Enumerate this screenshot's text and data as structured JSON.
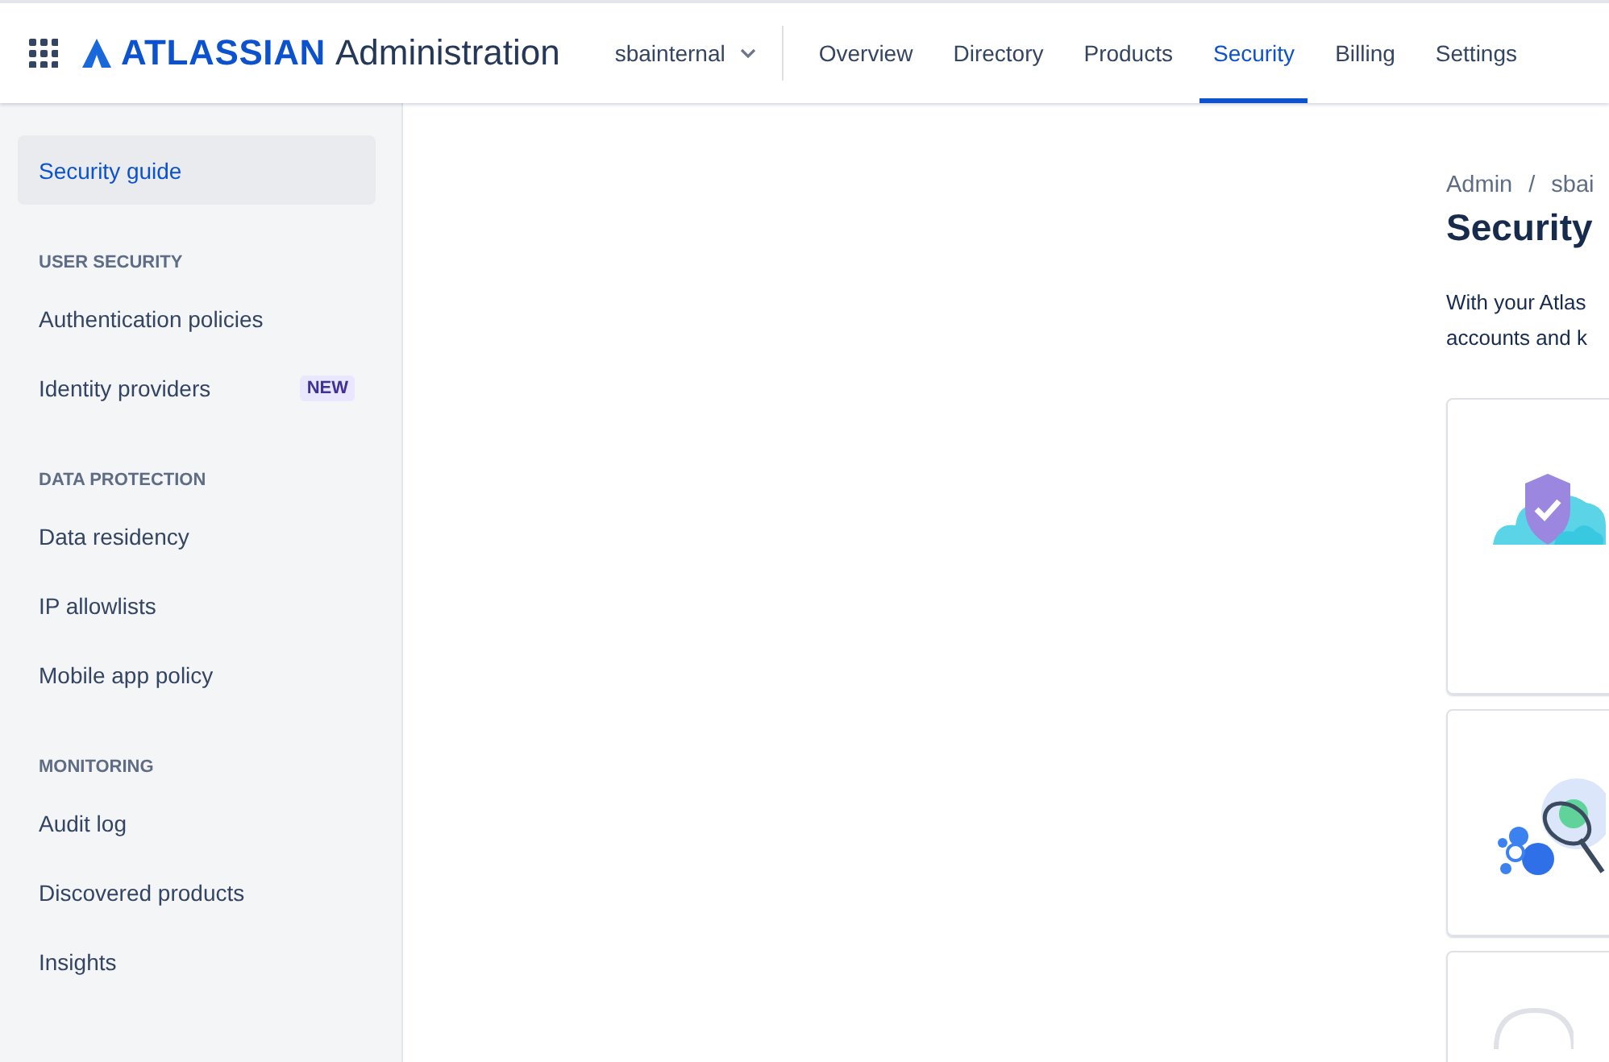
{
  "top_nav": {
    "logo": "ATLASSIAN",
    "product": "Administration",
    "org_switcher": "sbainternal",
    "tabs": [
      {
        "label": "Overview",
        "selected": false
      },
      {
        "label": "Directory",
        "selected": false
      },
      {
        "label": "Products",
        "selected": false
      },
      {
        "label": "Security",
        "selected": true
      },
      {
        "label": "Billing",
        "selected": false
      },
      {
        "label": "Settings",
        "selected": false
      }
    ]
  },
  "sidebar": {
    "items": [
      {
        "label": "Security guide",
        "selected": true
      }
    ],
    "sections": [
      {
        "heading": "USER SECURITY",
        "items": [
          {
            "label": "Authentication policies",
            "selected": false
          },
          {
            "label": "Identity providers",
            "selected": false,
            "badge": "NEW"
          }
        ]
      },
      {
        "heading": "DATA PROTECTION",
        "items": [
          {
            "label": "Data residency",
            "selected": false
          },
          {
            "label": "IP allowlists",
            "selected": false
          },
          {
            "label": "Mobile app policy",
            "selected": false
          }
        ]
      },
      {
        "heading": "MONITORING",
        "items": [
          {
            "label": "Audit log",
            "selected": false
          },
          {
            "label": "Discovered products",
            "selected": false
          },
          {
            "label": "Insights",
            "selected": false
          }
        ]
      }
    ]
  },
  "main": {
    "breadcrumbs": [
      "Admin",
      "sbai"
    ],
    "breadcrumb_separator": "/",
    "title": "Security",
    "description": [
      "With your Atlas",
      "accounts and k"
    ],
    "cards": [
      {
        "kind": "shield"
      },
      {
        "kind": "net"
      },
      {
        "kind": "outline"
      }
    ]
  }
}
